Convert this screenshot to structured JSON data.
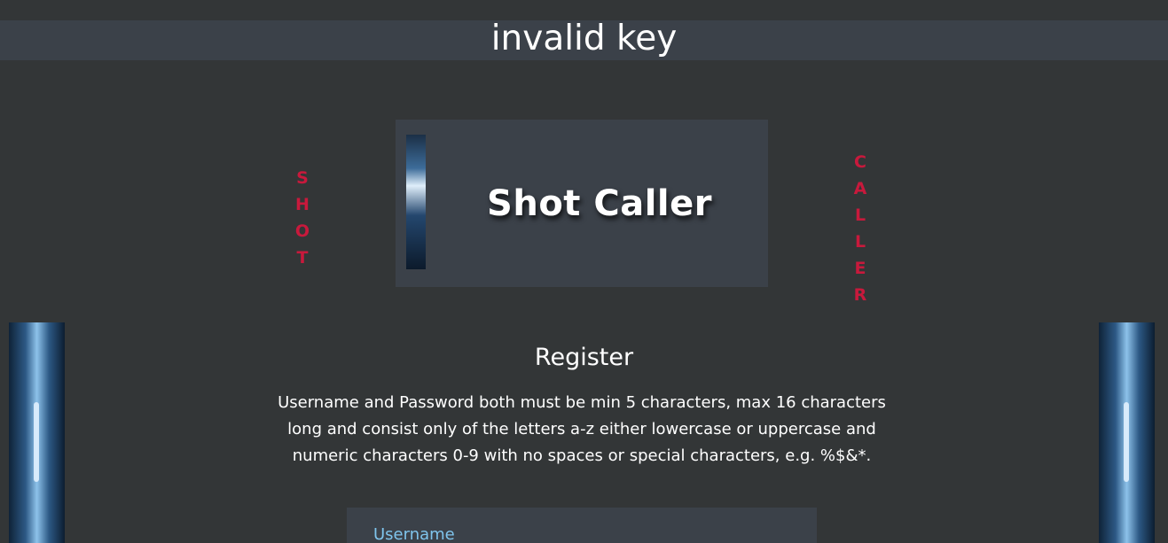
{
  "error": {
    "message": "invalid key"
  },
  "side_words": {
    "left": [
      "S",
      "H",
      "O",
      "T"
    ],
    "right": [
      "C",
      "A",
      "L",
      "L",
      "E",
      "R"
    ]
  },
  "hero": {
    "title": "Shot Caller"
  },
  "register": {
    "heading": "Register",
    "rules": "Username and Password both must be min 5 characters, max 16 characters long and consist only of the letters a-z either lowercase or uppercase and numeric characters 0-9 with no spaces or special characters, e.g. %$&*."
  },
  "form": {
    "username_label": "Username"
  },
  "colors": {
    "background": "#333637",
    "panel": "#3b4149",
    "accent_red": "#c8193c",
    "label_blue": "#7fc4ec"
  }
}
